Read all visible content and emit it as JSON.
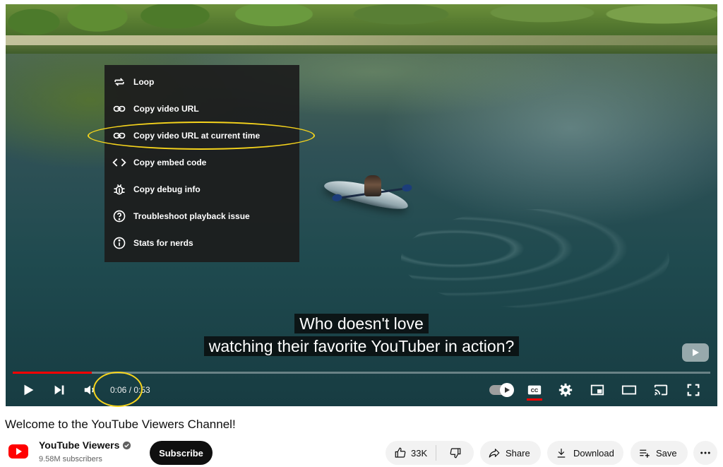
{
  "player": {
    "context_menu": {
      "items": [
        {
          "label": "Loop",
          "icon": "loop-icon"
        },
        {
          "label": "Copy video URL",
          "icon": "link-icon"
        },
        {
          "label": "Copy video URL at current time",
          "icon": "link-icon"
        },
        {
          "label": "Copy embed code",
          "icon": "code-icon"
        },
        {
          "label": "Copy debug info",
          "icon": "bug-icon"
        },
        {
          "label": "Troubleshoot playback issue",
          "icon": "help-circle-icon"
        },
        {
          "label": "Stats for nerds",
          "icon": "info-circle-icon"
        }
      ]
    },
    "captions": {
      "line1": "Who doesn't love",
      "line2": "watching their favorite YouTuber in action?"
    },
    "progress_fraction": 0.113,
    "time_display": "0:06 / 0:53",
    "annotation_color": "#f6d41c",
    "progress_color": "#ff0000"
  },
  "video": {
    "title": "Welcome to the YouTube Viewers Channel!"
  },
  "channel": {
    "name": "YouTube Viewers",
    "subscribers": "9.58M subscribers",
    "subscribe_label": "Subscribe",
    "logo_color": "#ff0000"
  },
  "actions": {
    "like_count": "33K",
    "share_label": "Share",
    "download_label": "Download",
    "save_label": "Save"
  }
}
